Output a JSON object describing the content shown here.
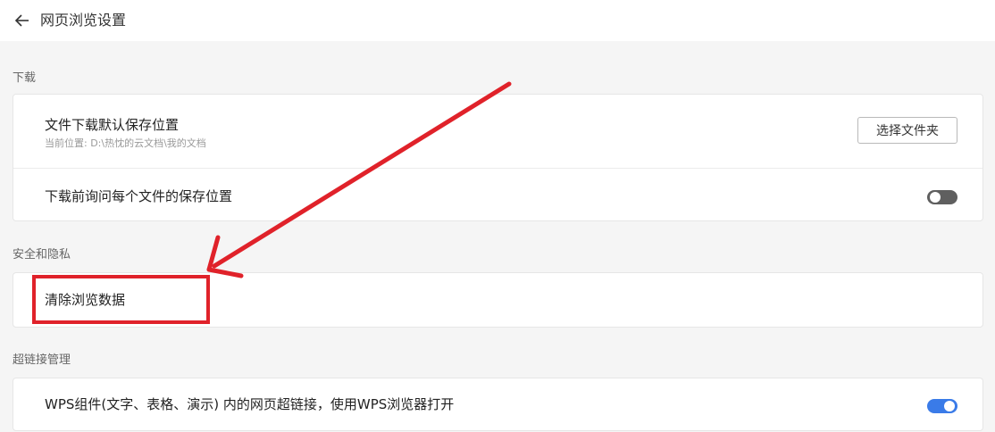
{
  "header": {
    "title": "网页浏览设置",
    "back_icon": "arrow-left-icon"
  },
  "sections": {
    "download": {
      "title": "下载",
      "default_location": {
        "label": "文件下载默认保存位置",
        "sub": "当前位置: D:\\热忱的云文档\\我的文档",
        "button": "选择文件夹"
      },
      "ask_location": {
        "label": "下载前询问每个文件的保存位置",
        "toggle_state": "off"
      }
    },
    "security": {
      "title": "安全和隐私",
      "clear_data": {
        "label": "清除浏览数据"
      }
    },
    "hyperlink": {
      "title": "超链接管理",
      "open_with_wps": {
        "label": "WPS组件(文字、表格、演示) 内的网页超链接，使用WPS浏览器打开",
        "toggle_state": "on"
      }
    }
  },
  "annotation": {
    "color": "#e0222a"
  },
  "colors": {
    "toggle_on": "#3a7be8",
    "toggle_off": "#5f5f5f",
    "background": "#f5f5f5"
  }
}
